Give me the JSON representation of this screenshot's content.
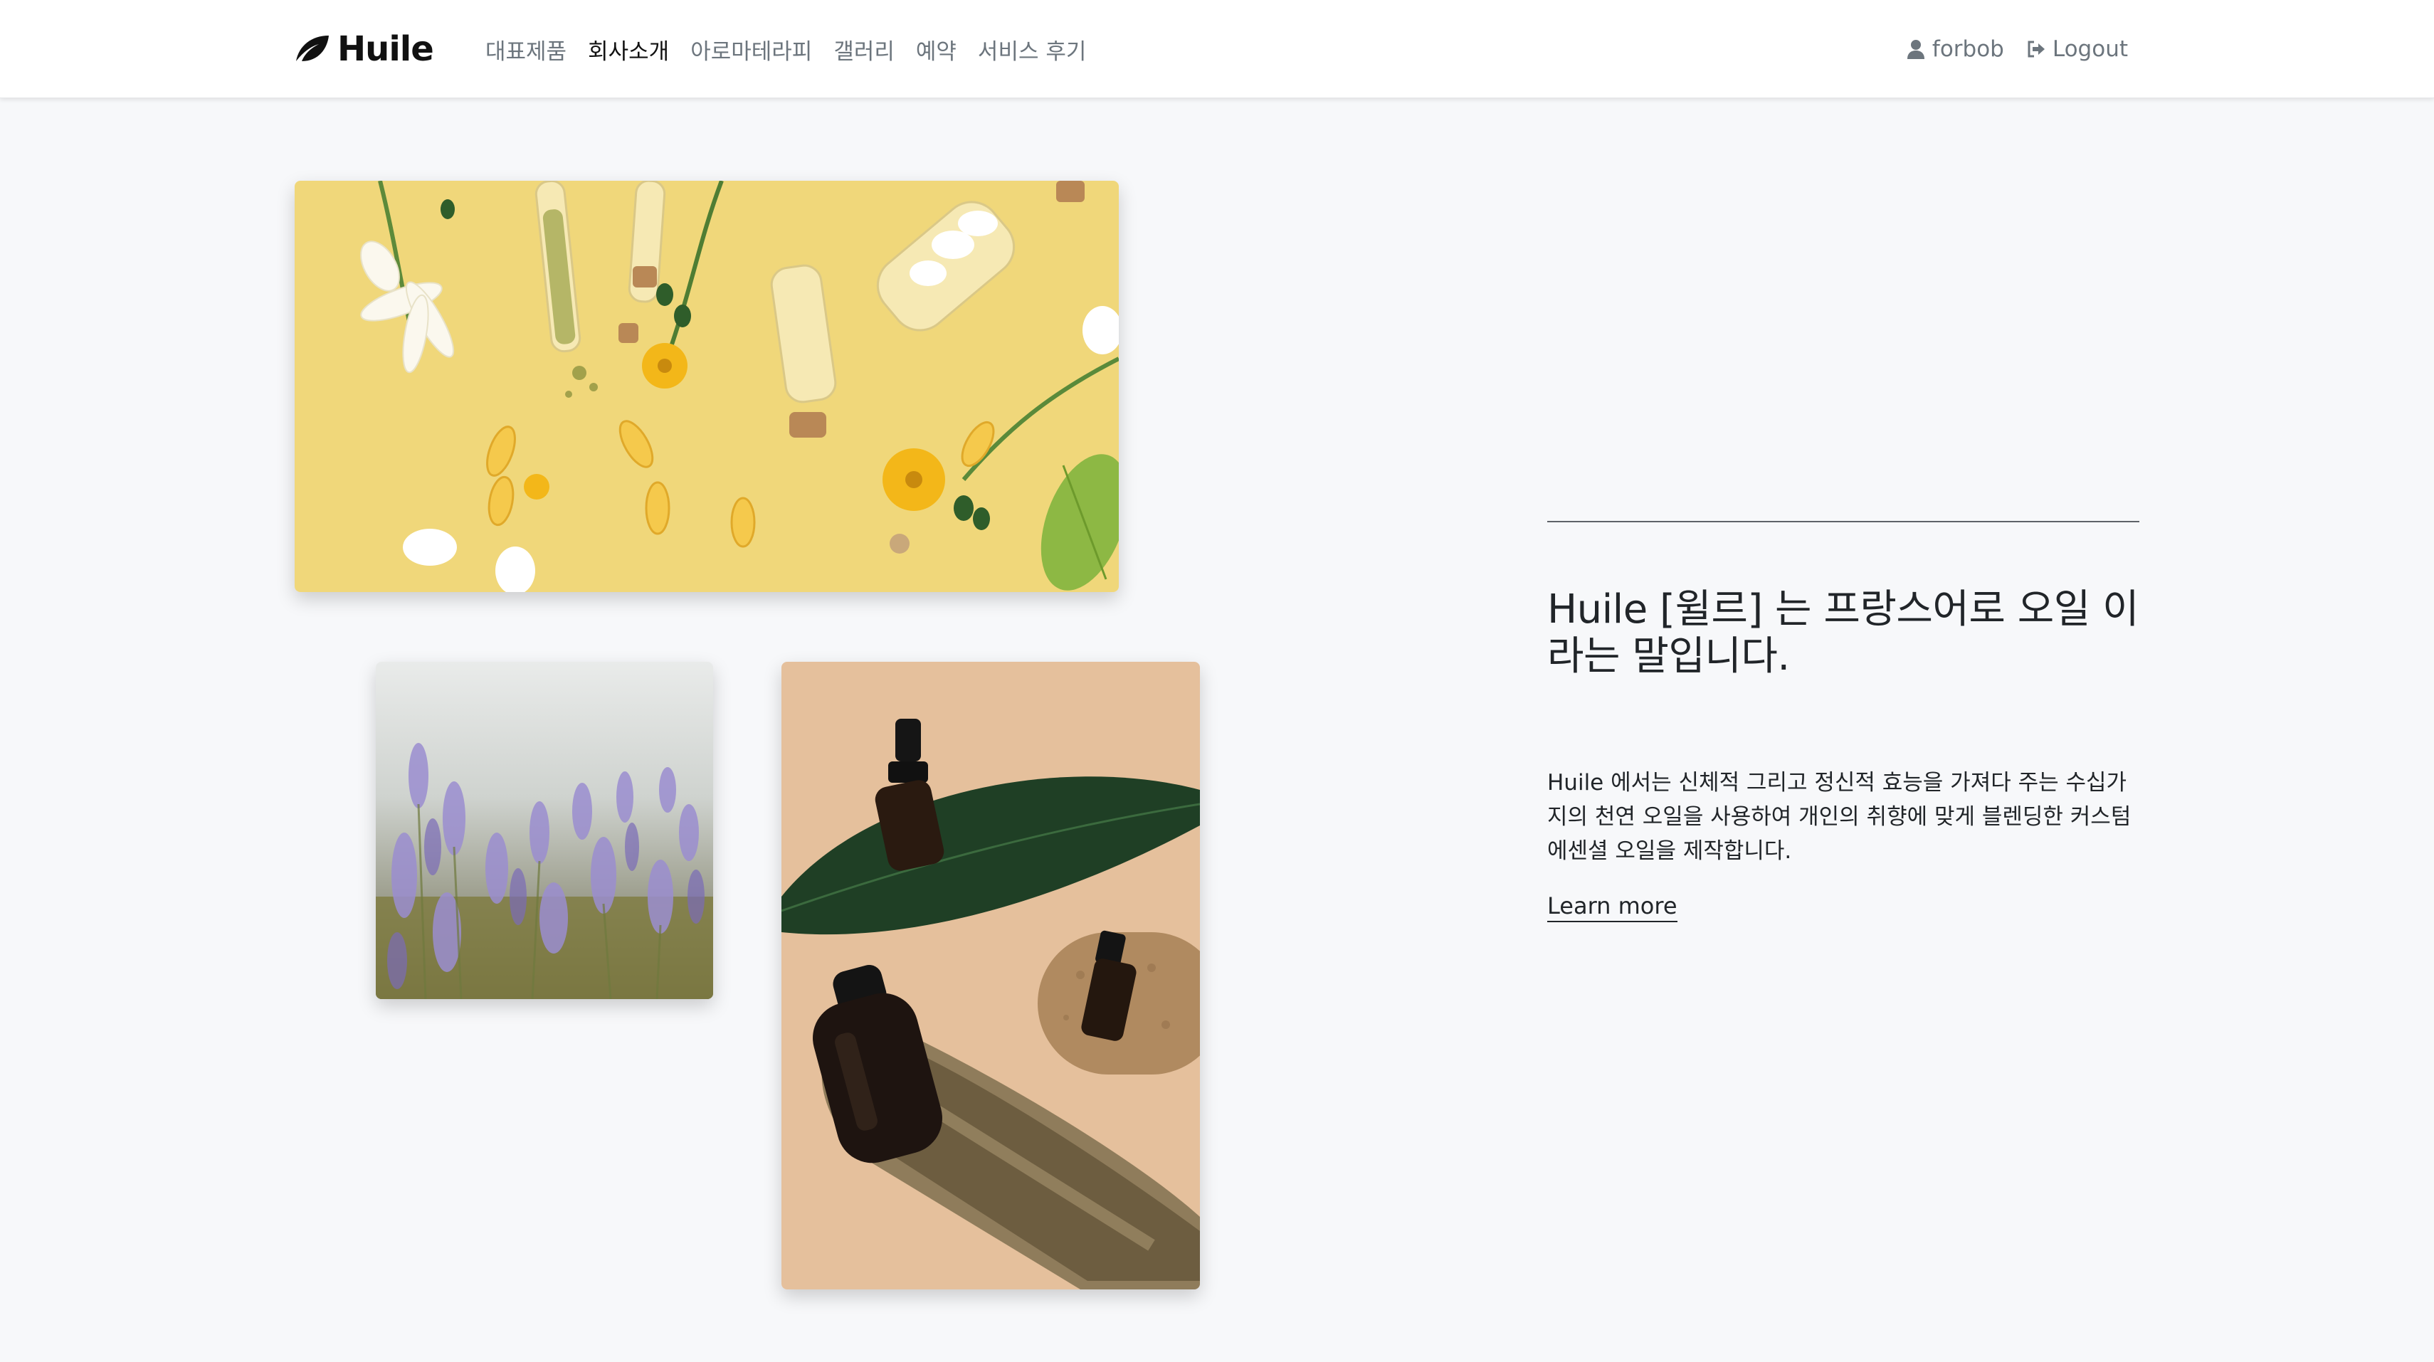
{
  "brand": {
    "name": "Huile",
    "icon": "leaf-icon"
  },
  "nav": {
    "items": [
      {
        "label": "대표제품",
        "active": false
      },
      {
        "label": "회사소개",
        "active": true
      },
      {
        "label": "아로마테라피",
        "active": false
      },
      {
        "label": "갤러리",
        "active": false
      },
      {
        "label": "예약",
        "active": false
      },
      {
        "label": "서비스 후기",
        "active": false
      }
    ],
    "user": {
      "icon": "user-icon",
      "label": "forbob"
    },
    "logout": {
      "icon": "logout-icon",
      "label": "Logout"
    }
  },
  "about": {
    "headline": "Huile [윌르] 는 프랑스어로 오일 이라는 말입니다.",
    "description": "Huile 에서는 신체적 그리고 정신적 효능을 가져다 주는 수십가지의 천연 오일을 사용하여 개인의 취향에 맞게 블렌딩한 커스텀 에센셜 오일을 제작합니다.",
    "learn_more": "Learn more"
  },
  "images": [
    {
      "name": "herbs-and-vials-photo"
    },
    {
      "name": "lavender-field-photo"
    },
    {
      "name": "essential-oil-bottles-photo"
    }
  ],
  "colors": {
    "background": "#f7f8fa",
    "navbar": "#ffffff",
    "nav_text": "#6c757d",
    "nav_active": "#111111",
    "text": "#212529"
  }
}
